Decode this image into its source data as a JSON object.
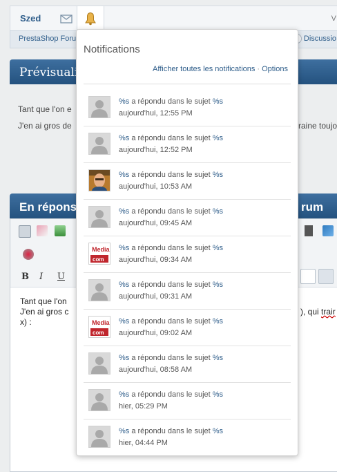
{
  "topbar": {
    "username": "Szed",
    "right_fragment": "V"
  },
  "breadcrumb": {
    "left": "PrestaShop Forum",
    "right": "Discussio"
  },
  "preview_header": {
    "title": "Prévisuali"
  },
  "preview_text": {
    "line1": "Tant que l'on e",
    "line2": "J'en ai gros de",
    "line2_right": "raine toujo"
  },
  "reply_header": {
    "title": "En répons",
    "title_end": "rum"
  },
  "editor": {
    "bold": "B",
    "italic": "I",
    "underline": "U",
    "text_line1": "Tant que l'on",
    "text_line2": "J'en ai gros c",
    "text_line2_right": "), qui",
    "text_line2_right_word": "trair",
    "text_line3": "x) :"
  },
  "notifications": {
    "title": "Notifications",
    "show_all": "Afficher toutes les notifications",
    "separator": "·",
    "options": "Options",
    "items": [
      {
        "ph1": "%s",
        "middle": " a répondu dans le sujet ",
        "ph2": "%s",
        "time": "aujourd'hui, 12:55 PM",
        "avatar": "default"
      },
      {
        "ph1": "%s",
        "middle": " a répondu dans le sujet ",
        "ph2": "%s",
        "time": "aujourd'hui, 12:52 PM",
        "avatar": "default"
      },
      {
        "ph1": "%s",
        "middle": " a répondu dans le sujet ",
        "ph2": "%s",
        "time": "aujourd'hui, 10:53 AM",
        "avatar": "photo"
      },
      {
        "ph1": "%s",
        "middle": " a répondu dans le sujet ",
        "ph2": "%s",
        "time": "aujourd'hui, 09:45 AM",
        "avatar": "default"
      },
      {
        "ph1": "%s",
        "middle": " a répondu dans le sujet ",
        "ph2": "%s",
        "time": "aujourd'hui, 09:34 AM",
        "avatar": "media"
      },
      {
        "ph1": "%s",
        "middle": " a répondu dans le sujet ",
        "ph2": "%s",
        "time": "aujourd'hui, 09:31 AM",
        "avatar": "default"
      },
      {
        "ph1": "%s",
        "middle": " a répondu dans le sujet ",
        "ph2": "%s",
        "time": "aujourd'hui, 09:02 AM",
        "avatar": "media"
      },
      {
        "ph1": "%s",
        "middle": " a répondu dans le sujet ",
        "ph2": "%s",
        "time": "aujourd'hui, 08:58 AM",
        "avatar": "default"
      },
      {
        "ph1": "%s",
        "middle": " a répondu dans le sujet ",
        "ph2": "%s",
        "time": "hier, 05:29 PM",
        "avatar": "default"
      },
      {
        "ph1": "%s",
        "middle": " a répondu dans le sujet ",
        "ph2": "%s",
        "time": "hier, 04:44 PM",
        "avatar": "default"
      }
    ],
    "media_logo": {
      "top": "Media",
      "bottom": "com"
    }
  },
  "icons": {
    "mail": "mail-icon",
    "bell": "bell-icon"
  },
  "colors": {
    "link": "#2e5d8a",
    "header_blue": "#2c5b88",
    "media_red": "#c0262d"
  }
}
